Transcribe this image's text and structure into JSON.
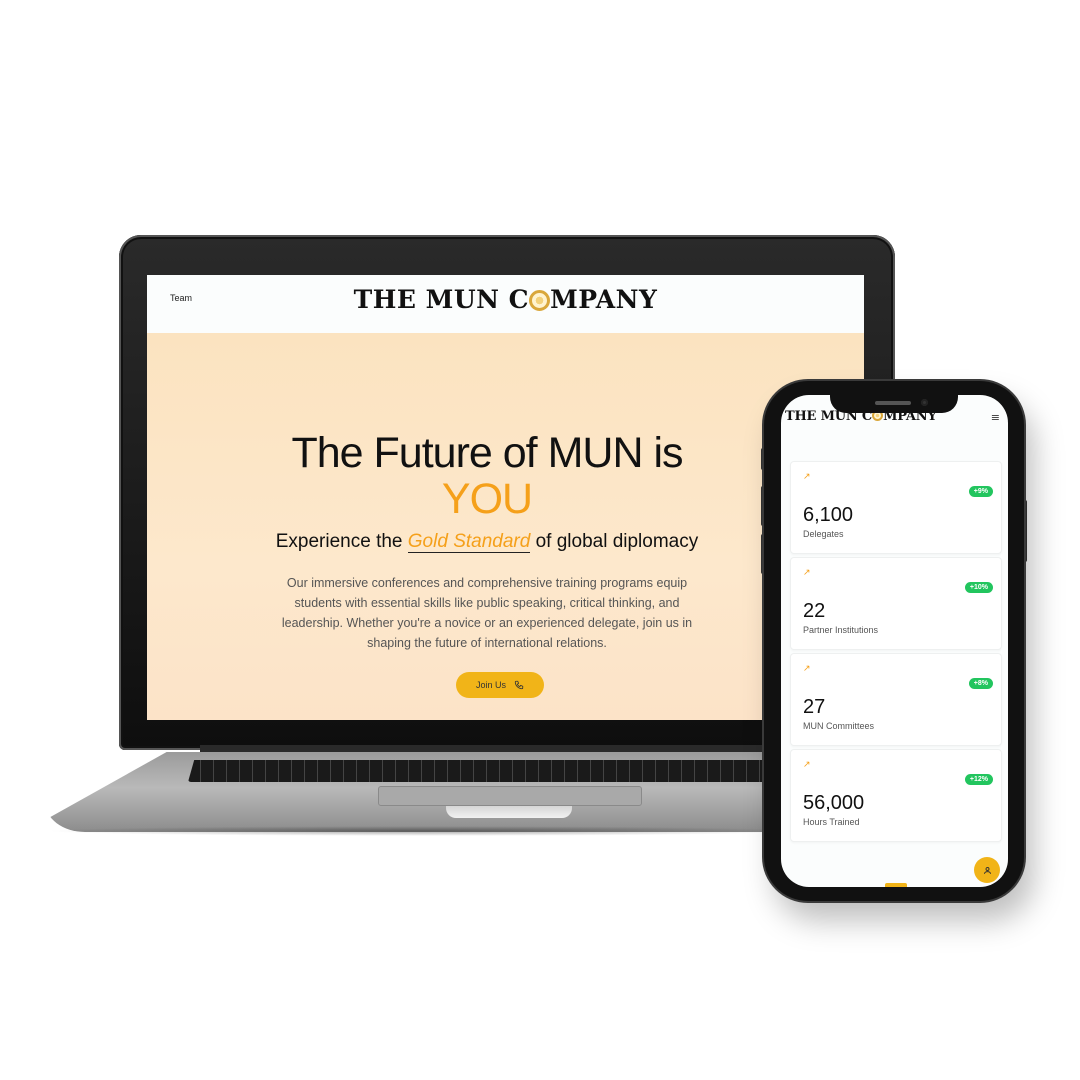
{
  "brand": {
    "logo_text_before": "THE MUN C",
    "logo_text_after": "MPANY",
    "emblem_icon": "globe-emblem-icon",
    "accent_color": "#f5a01a",
    "button_color": "#f1b418",
    "badge_color": "#22c55e"
  },
  "laptop": {
    "nav": {
      "team_label": "Team"
    },
    "hero": {
      "title_line1": "The Future of MUN is",
      "title_line2": "YOU",
      "subtitle_before": "Experience the ",
      "subtitle_highlight": "Gold Standard",
      "subtitle_after": " of global diplomacy",
      "body": "Our immersive conferences and comprehensive training programs equip students with essential skills like public speaking, critical thinking, and leadership. Whether you're a novice or an experienced delegate, join us in shaping the future of international relations.",
      "cta_label": "Join Us",
      "cta_icon": "phone-icon"
    }
  },
  "phone": {
    "menu_icon": "≡",
    "stats": [
      {
        "change": "+9%",
        "value": "6,100",
        "label": "Delegates"
      },
      {
        "change": "+10%",
        "value": "22",
        "label": "Partner Institutions"
      },
      {
        "change": "+8%",
        "value": "27",
        "label": "MUN Committees"
      },
      {
        "change": "+12%",
        "value": "56,000",
        "label": "Hours Trained"
      }
    ],
    "trend_icon": "↗",
    "fab_icon": "user-icon"
  }
}
